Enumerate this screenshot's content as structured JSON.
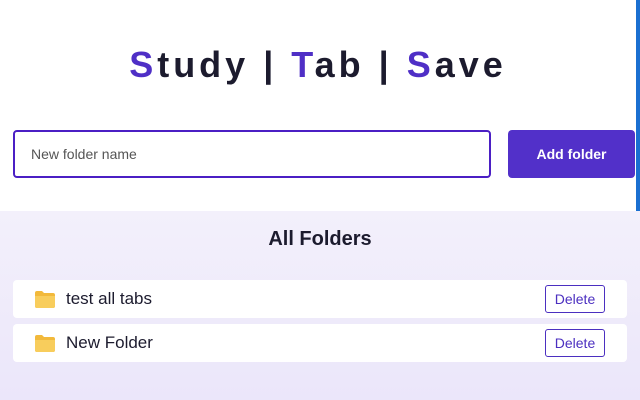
{
  "header": {
    "title_parts": [
      {
        "text": "S",
        "accent": true
      },
      {
        "text": "tudy | ",
        "accent": false
      },
      {
        "text": "T",
        "accent": true
      },
      {
        "text": "ab | ",
        "accent": false
      },
      {
        "text": "S",
        "accent": true
      },
      {
        "text": "ave",
        "accent": false
      }
    ]
  },
  "new_folder": {
    "value": "",
    "placeholder": "New folder name",
    "add_label": "Add folder"
  },
  "folders": {
    "title": "All Folders",
    "items": [
      {
        "name": "test all tabs",
        "delete_label": "Delete",
        "icon": "folder-icon"
      },
      {
        "name": "New Folder",
        "delete_label": "Delete",
        "icon": "folder-icon"
      }
    ]
  },
  "colors": {
    "accent": "#5230c9",
    "title_text": "#1c1b2e",
    "folder_icon": "#f6c54a",
    "section_bg": "#f0ecfb"
  }
}
